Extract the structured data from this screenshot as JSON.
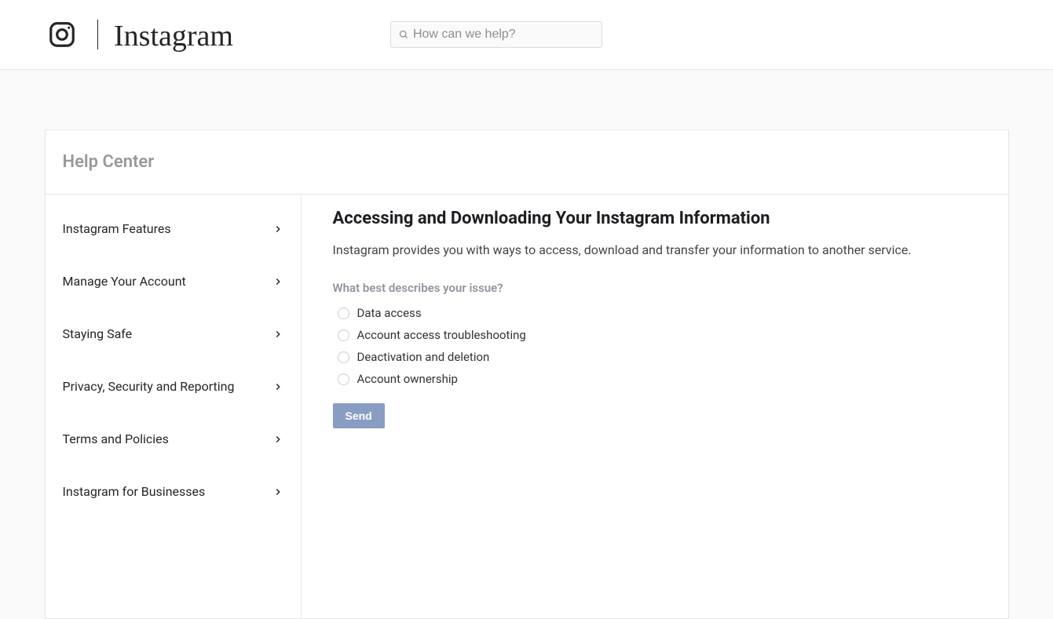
{
  "brand": "Instagram",
  "search": {
    "placeholder": "How can we help?"
  },
  "help_center": {
    "title": "Help Center"
  },
  "sidebar": {
    "items": [
      {
        "label": "Instagram Features"
      },
      {
        "label": "Manage Your Account"
      },
      {
        "label": "Staying Safe"
      },
      {
        "label": "Privacy, Security and Reporting"
      },
      {
        "label": "Terms and Policies"
      },
      {
        "label": "Instagram for Businesses"
      }
    ]
  },
  "article": {
    "title": "Accessing and Downloading Your Instagram Information",
    "intro": "Instagram provides you with ways to access, download and transfer your information to another service.",
    "question": "What best describes your issue?",
    "options": [
      {
        "label": "Data access"
      },
      {
        "label": "Account access troubleshooting"
      },
      {
        "label": "Deactivation and deletion"
      },
      {
        "label": "Account ownership"
      }
    ],
    "send_label": "Send"
  }
}
